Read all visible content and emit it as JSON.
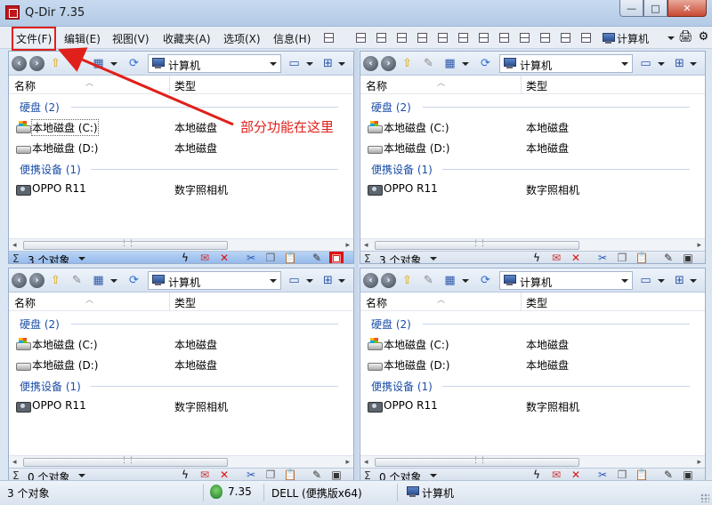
{
  "window": {
    "title": "Q-Dir 7.35",
    "min": "—",
    "max": "□",
    "close": "✕"
  },
  "menu": {
    "file": "文件(F)",
    "edit": "编辑(E)",
    "view": "视图(V)",
    "favorites": "收藏夹(A)",
    "options": "选项(X)",
    "info": "信息(H)",
    "computer": "计算机"
  },
  "annotation": {
    "text": "部分功能在这里",
    "color": "#e0201b"
  },
  "panes": [
    {
      "address": "计算机",
      "col_name": "名称",
      "col_type": "类型",
      "groups": [
        {
          "label": "硬盘 (2)",
          "items": [
            {
              "name": "本地磁盘 (C:)",
              "type": "本地磁盘",
              "icon": "system-drive-icon"
            },
            {
              "name": "本地磁盘 (D:)",
              "type": "本地磁盘",
              "icon": "drive-icon"
            }
          ]
        },
        {
          "label": "便携设备 (1)",
          "items": [
            {
              "name": "OPPO R11",
              "type": "数字照相机",
              "icon": "camera-icon"
            }
          ]
        }
      ],
      "sigma": "Σ",
      "status": "3 个对象"
    },
    {
      "address": "计算机",
      "col_name": "名称",
      "col_type": "类型",
      "groups": [
        {
          "label": "硬盘 (2)",
          "items": [
            {
              "name": "本地磁盘 (C:)",
              "type": "本地磁盘",
              "icon": "system-drive-icon"
            },
            {
              "name": "本地磁盘 (D:)",
              "type": "本地磁盘",
              "icon": "drive-icon"
            }
          ]
        },
        {
          "label": "便携设备 (1)",
          "items": [
            {
              "name": "OPPO R11",
              "type": "数字照相机",
              "icon": "camera-icon"
            }
          ]
        }
      ],
      "sigma": "Σ",
      "status": "3 个对象"
    },
    {
      "address": "计算机",
      "col_name": "名称",
      "col_type": "类型",
      "groups": [
        {
          "label": "硬盘 (2)",
          "items": [
            {
              "name": "本地磁盘 (C:)",
              "type": "本地磁盘",
              "icon": "system-drive-icon"
            },
            {
              "name": "本地磁盘 (D:)",
              "type": "本地磁盘",
              "icon": "drive-icon"
            }
          ]
        },
        {
          "label": "便携设备 (1)",
          "items": [
            {
              "name": "OPPO R11",
              "type": "数字照相机",
              "icon": "camera-icon"
            }
          ]
        }
      ],
      "sigma": "Σ",
      "status": "0 个对象"
    },
    {
      "address": "计算机",
      "col_name": "名称",
      "col_type": "类型",
      "groups": [
        {
          "label": "硬盘 (2)",
          "items": [
            {
              "name": "本地磁盘 (C:)",
              "type": "本地磁盘",
              "icon": "system-drive-icon"
            },
            {
              "name": "本地磁盘 (D:)",
              "type": "本地磁盘",
              "icon": "drive-icon"
            }
          ]
        },
        {
          "label": "便携设备 (1)",
          "items": [
            {
              "name": "OPPO R11",
              "type": "数字照相机",
              "icon": "camera-icon"
            }
          ]
        }
      ],
      "sigma": "Σ",
      "status": "0 个对象"
    }
  ],
  "statusbar": {
    "objects": "3 个对象",
    "version": "7.35",
    "host": "DELL (便携版x64)",
    "location": "计算机"
  }
}
